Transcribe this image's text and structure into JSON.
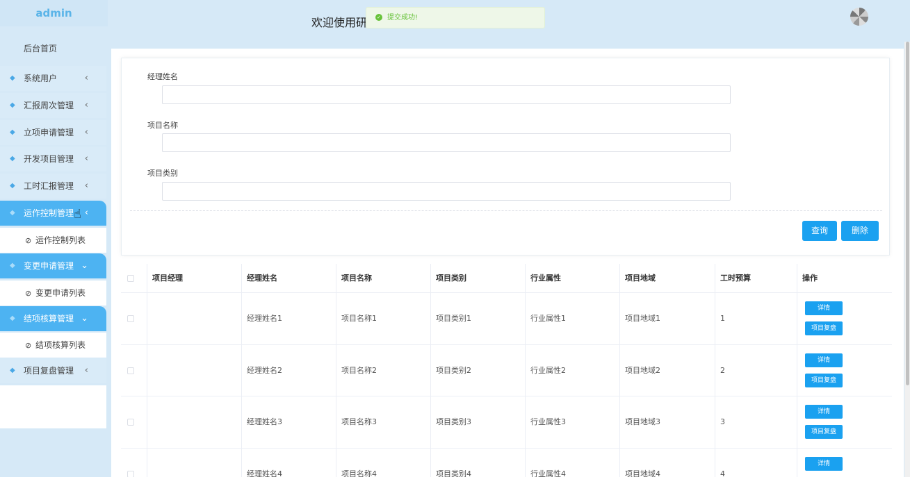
{
  "sidebar": {
    "brand": "admin",
    "home": "后台首页",
    "items": [
      {
        "label": "系统用户",
        "icon": "diamond-icon",
        "expanded": false
      },
      {
        "label": "汇报周次管理",
        "icon": "diamond-icon",
        "expanded": false
      },
      {
        "label": "立项申请管理",
        "icon": "diamond-icon",
        "expanded": false
      },
      {
        "label": "开发项目管理",
        "icon": "diamond-icon",
        "expanded": false
      },
      {
        "label": "工时汇报管理",
        "icon": "diamond-icon",
        "expanded": false
      },
      {
        "label": "运作控制管理",
        "icon": "diamond-icon",
        "expanded": true,
        "sub": "运作控制列表"
      },
      {
        "label": "变更申请管理",
        "icon": "diamond-icon",
        "expanded": true,
        "sub": "变更申请列表"
      },
      {
        "label": "结项核算管理",
        "icon": "diamond-icon",
        "expanded": true,
        "sub": "结项核算列表"
      },
      {
        "label": "项目复盘管理",
        "icon": "diamond-icon",
        "expanded": false
      }
    ]
  },
  "header": {
    "welcome": "欢迎使用研",
    "toast": "提交成功!"
  },
  "form": {
    "fields": [
      {
        "label": "经理姓名",
        "value": ""
      },
      {
        "label": "项目名称",
        "value": ""
      },
      {
        "label": "项目类别",
        "value": ""
      }
    ],
    "query_label": "查询",
    "delete_label": "删除"
  },
  "table": {
    "headers": [
      "项目经理",
      "经理姓名",
      "项目名称",
      "项目类别",
      "行业属性",
      "项目地域",
      "工时预算",
      "操作"
    ],
    "rows": [
      {
        "manager": "",
        "name": "经理姓名1",
        "project": "项目名称1",
        "category": "项目类别1",
        "industry": "行业属性1",
        "region": "项目地域1",
        "budget": "1"
      },
      {
        "manager": "",
        "name": "经理姓名2",
        "project": "项目名称2",
        "category": "项目类别2",
        "industry": "行业属性2",
        "region": "项目地域2",
        "budget": "2"
      },
      {
        "manager": "",
        "name": "经理姓名3",
        "project": "项目名称3",
        "category": "项目类别3",
        "industry": "行业属性3",
        "region": "项目地域3",
        "budget": "3"
      },
      {
        "manager": "",
        "name": "经理姓名4",
        "project": "项目名称4",
        "category": "项目类别4",
        "industry": "行业属性4",
        "region": "项目地域4",
        "budget": "4"
      }
    ],
    "detail_label": "详情",
    "review_label": "项目复盘"
  },
  "colors": {
    "accent": "#1aa1f0",
    "sidebar_active": "#4db3f2",
    "success": "#67c23a",
    "background": "#d6e9f7"
  }
}
